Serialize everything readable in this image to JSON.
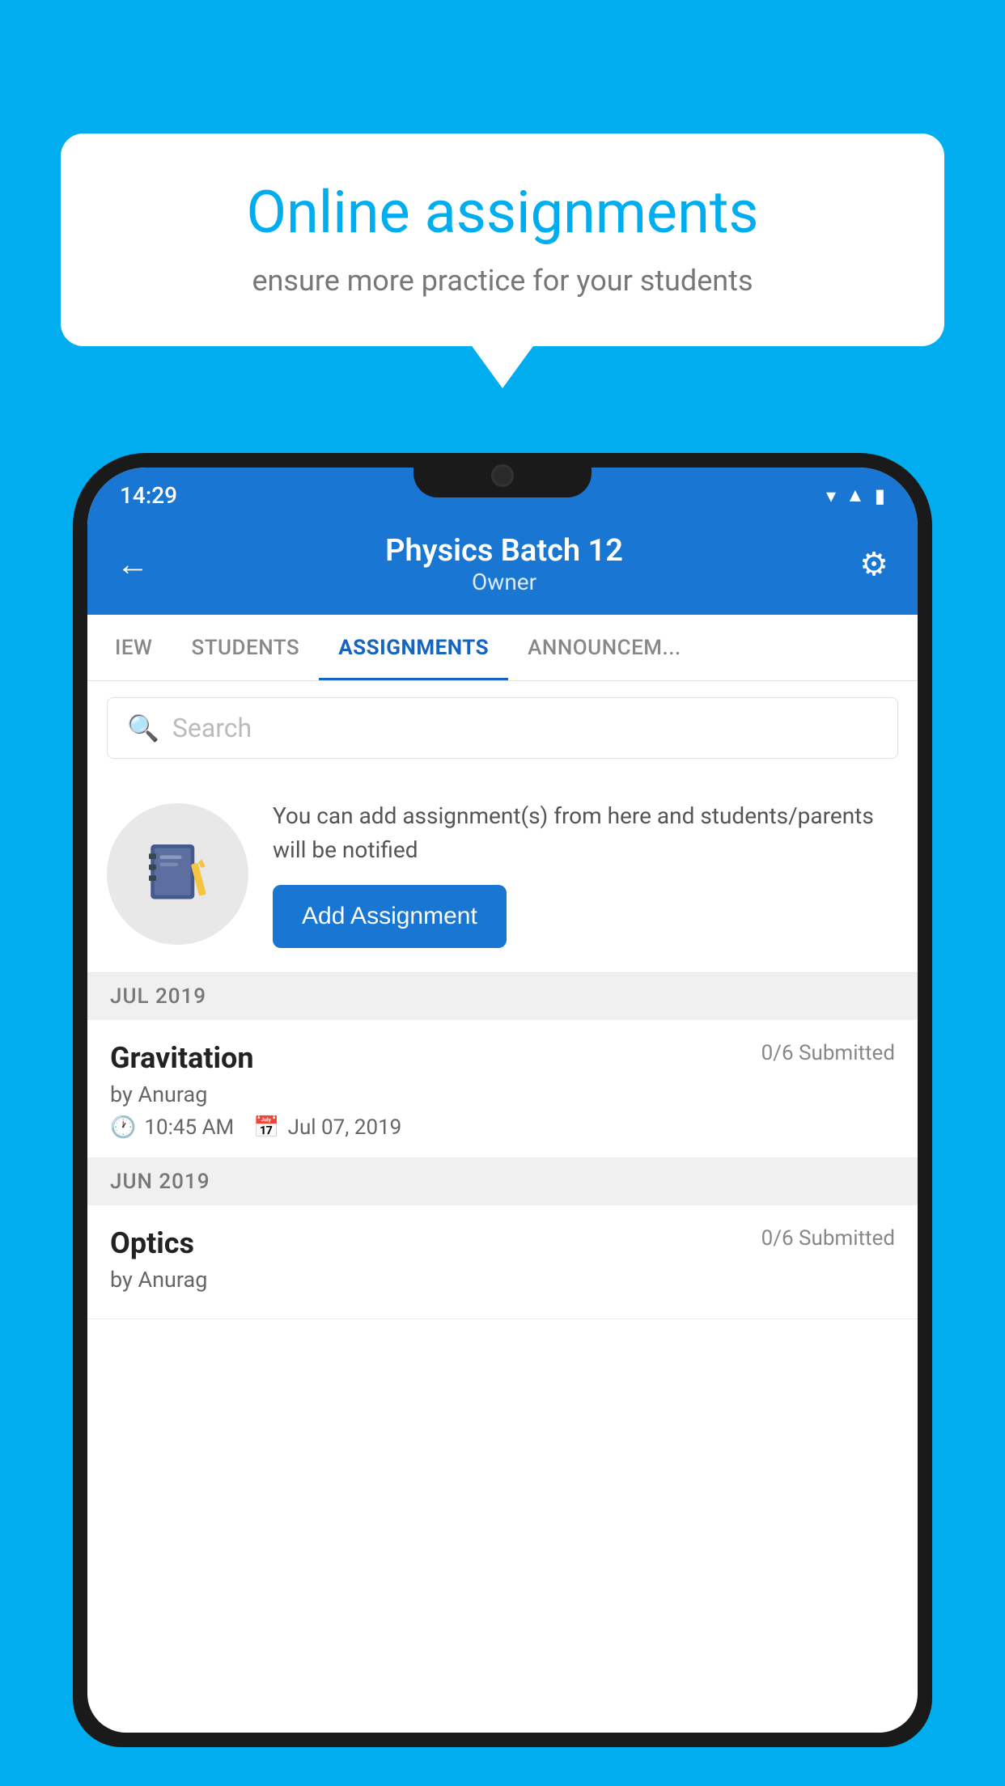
{
  "background_color": "#00AEEF",
  "speech_bubble": {
    "title": "Online assignments",
    "subtitle": "ensure more practice for your students"
  },
  "status_bar": {
    "time": "14:29",
    "icons": [
      "wifi",
      "signal",
      "battery"
    ]
  },
  "header": {
    "title": "Physics Batch 12",
    "subtitle": "Owner",
    "back_label": "←",
    "settings_label": "⚙"
  },
  "tabs": [
    {
      "label": "IEW",
      "active": false
    },
    {
      "label": "STUDENTS",
      "active": false
    },
    {
      "label": "ASSIGNMENTS",
      "active": true
    },
    {
      "label": "ANNOUNCEM...",
      "active": false
    }
  ],
  "search": {
    "placeholder": "Search"
  },
  "add_assignment_banner": {
    "description": "You can add assignment(s) from here and students/parents will be notified",
    "button_label": "Add Assignment"
  },
  "assignment_groups": [
    {
      "month": "JUL 2019",
      "assignments": [
        {
          "name": "Gravitation",
          "submitted": "0/6 Submitted",
          "by": "by Anurag",
          "time": "10:45 AM",
          "date": "Jul 07, 2019"
        }
      ]
    },
    {
      "month": "JUN 2019",
      "assignments": [
        {
          "name": "Optics",
          "submitted": "0/6 Submitted",
          "by": "by Anurag",
          "time": "",
          "date": ""
        }
      ]
    }
  ]
}
